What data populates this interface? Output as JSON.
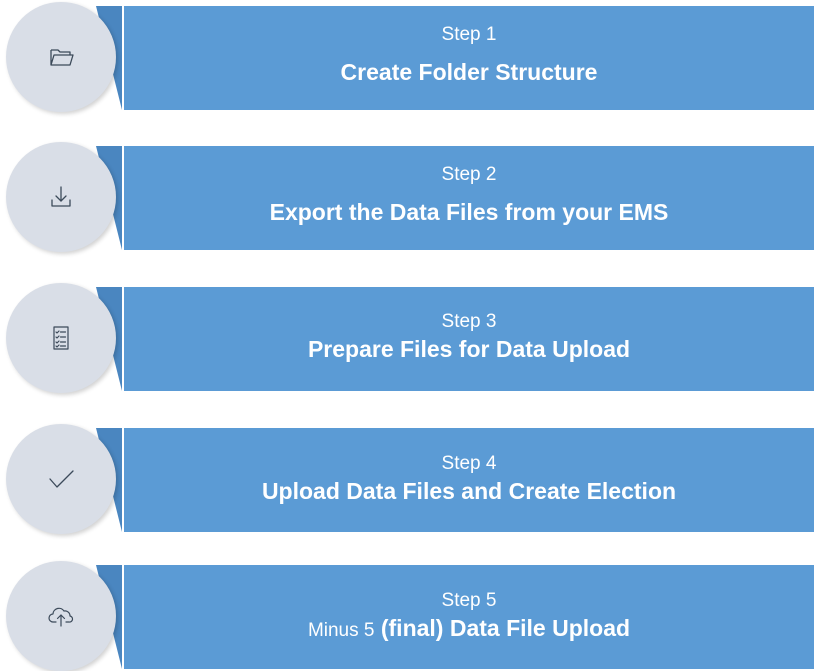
{
  "steps": [
    {
      "label": "Step 1",
      "title": "Create Folder Structure",
      "icon": "folder-icon"
    },
    {
      "label": "Step 2",
      "title": "Export the Data Files from your EMS",
      "icon": "download-icon"
    },
    {
      "label": "Step 3",
      "title": "Prepare Files for Data Upload",
      "icon": "checklist-icon"
    },
    {
      "label": "Step 4",
      "title": "Upload Data Files and Create Election",
      "icon": "checkmark-icon"
    },
    {
      "label": "Step 5",
      "title_prefix": "Minus 5",
      "title": "(final) Data File Upload",
      "icon": "cloud-upload-icon"
    }
  ],
  "colors": {
    "banner": "#5b9bd5",
    "circle": "#d9dee7",
    "text": "#ffffff",
    "icon_stroke": "#3c4a5a"
  }
}
